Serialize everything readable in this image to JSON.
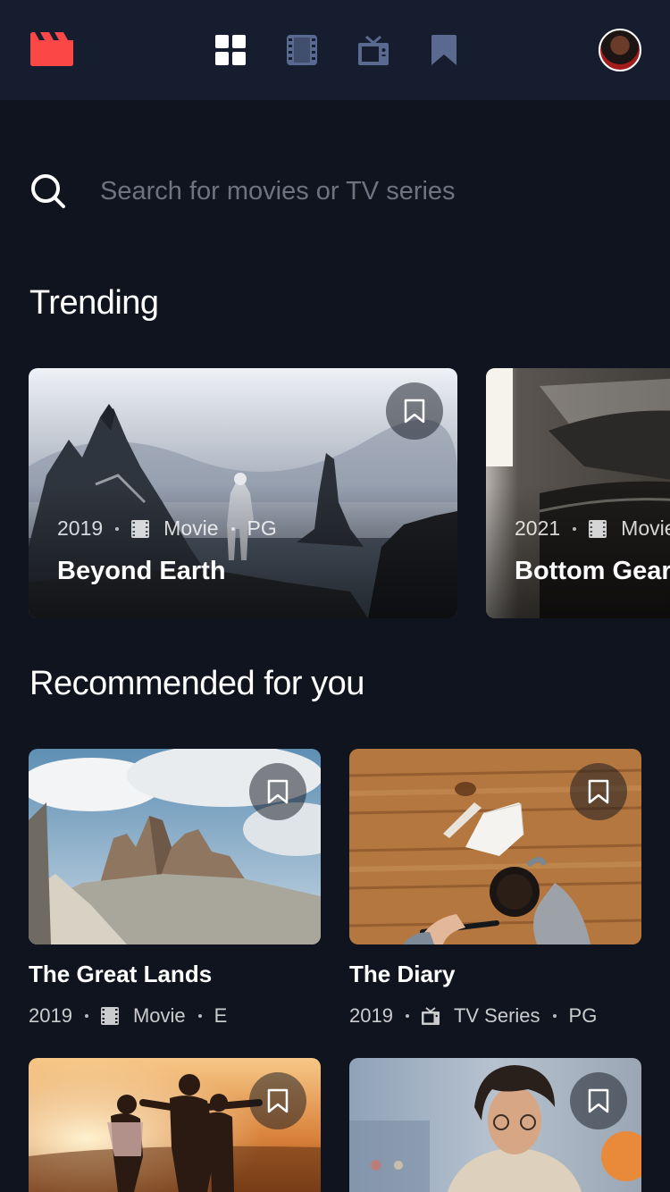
{
  "header": {
    "logo_icon": "movie-clapper-icon",
    "nav": [
      {
        "icon": "grid-icon",
        "label": "Home",
        "active": true
      },
      {
        "icon": "film-icon",
        "label": "Movies",
        "active": false
      },
      {
        "icon": "tv-icon",
        "label": "TV Series",
        "active": false
      },
      {
        "icon": "bookmark-icon",
        "label": "Bookmarked",
        "active": false
      }
    ],
    "avatar_icon": "user-avatar"
  },
  "search": {
    "placeholder": "Search for movies or TV series",
    "value": ""
  },
  "trending": {
    "title": "Trending",
    "items": [
      {
        "year": "2019",
        "category": "Movie",
        "category_icon": "film-icon",
        "rating": "PG",
        "title": "Beyond Earth"
      },
      {
        "year": "2021",
        "category": "Movie",
        "category_icon": "film-icon",
        "rating": "",
        "title": "Bottom Gear"
      }
    ]
  },
  "recommended": {
    "title": "Recommended for you",
    "items": [
      {
        "year": "2019",
        "category": "Movie",
        "category_icon": "film-icon",
        "rating": "E",
        "title": "The Great Lands"
      },
      {
        "year": "2019",
        "category": "TV Series",
        "category_icon": "tv-icon",
        "rating": "PG",
        "title": "The Diary"
      },
      {
        "year": "",
        "category": "",
        "category_icon": "",
        "rating": "",
        "title": ""
      },
      {
        "year": "",
        "category": "",
        "category_icon": "",
        "rating": "",
        "title": ""
      }
    ]
  },
  "colors": {
    "background": "#10141e",
    "header": "#161d2f",
    "accent": "#fc4747",
    "nav_inactive": "#5a698f",
    "text": "#ffffff"
  }
}
